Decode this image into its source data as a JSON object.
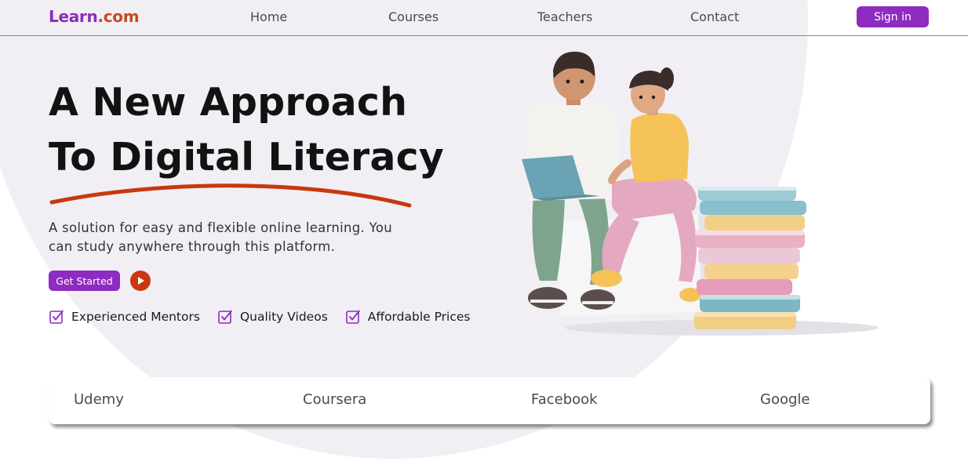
{
  "header": {
    "logo_part1": "Learn",
    "logo_part2": ".com",
    "nav": [
      "Home",
      "Courses",
      "Teachers",
      "Contact"
    ],
    "signin_label": "Sign in"
  },
  "hero": {
    "headline_line1": "A New Approach",
    "headline_line2": "To Digital Literacy",
    "subtext": "A solution for easy and flexible online learning. You can study anywhere through this platform.",
    "cta_label": "Get Started",
    "features": [
      "Experienced Mentors",
      "Quality Videos",
      "Affordable Prices"
    ]
  },
  "partners": [
    "Udemy",
    "Coursera",
    "Facebook",
    "Google"
  ],
  "colors": {
    "brand_purple": "#8e2bc0",
    "accent_orange": "#c9380f",
    "hero_bg": "#f1eff4"
  },
  "icons": {
    "play": "play-icon",
    "check": "checkbox-check-icon"
  }
}
